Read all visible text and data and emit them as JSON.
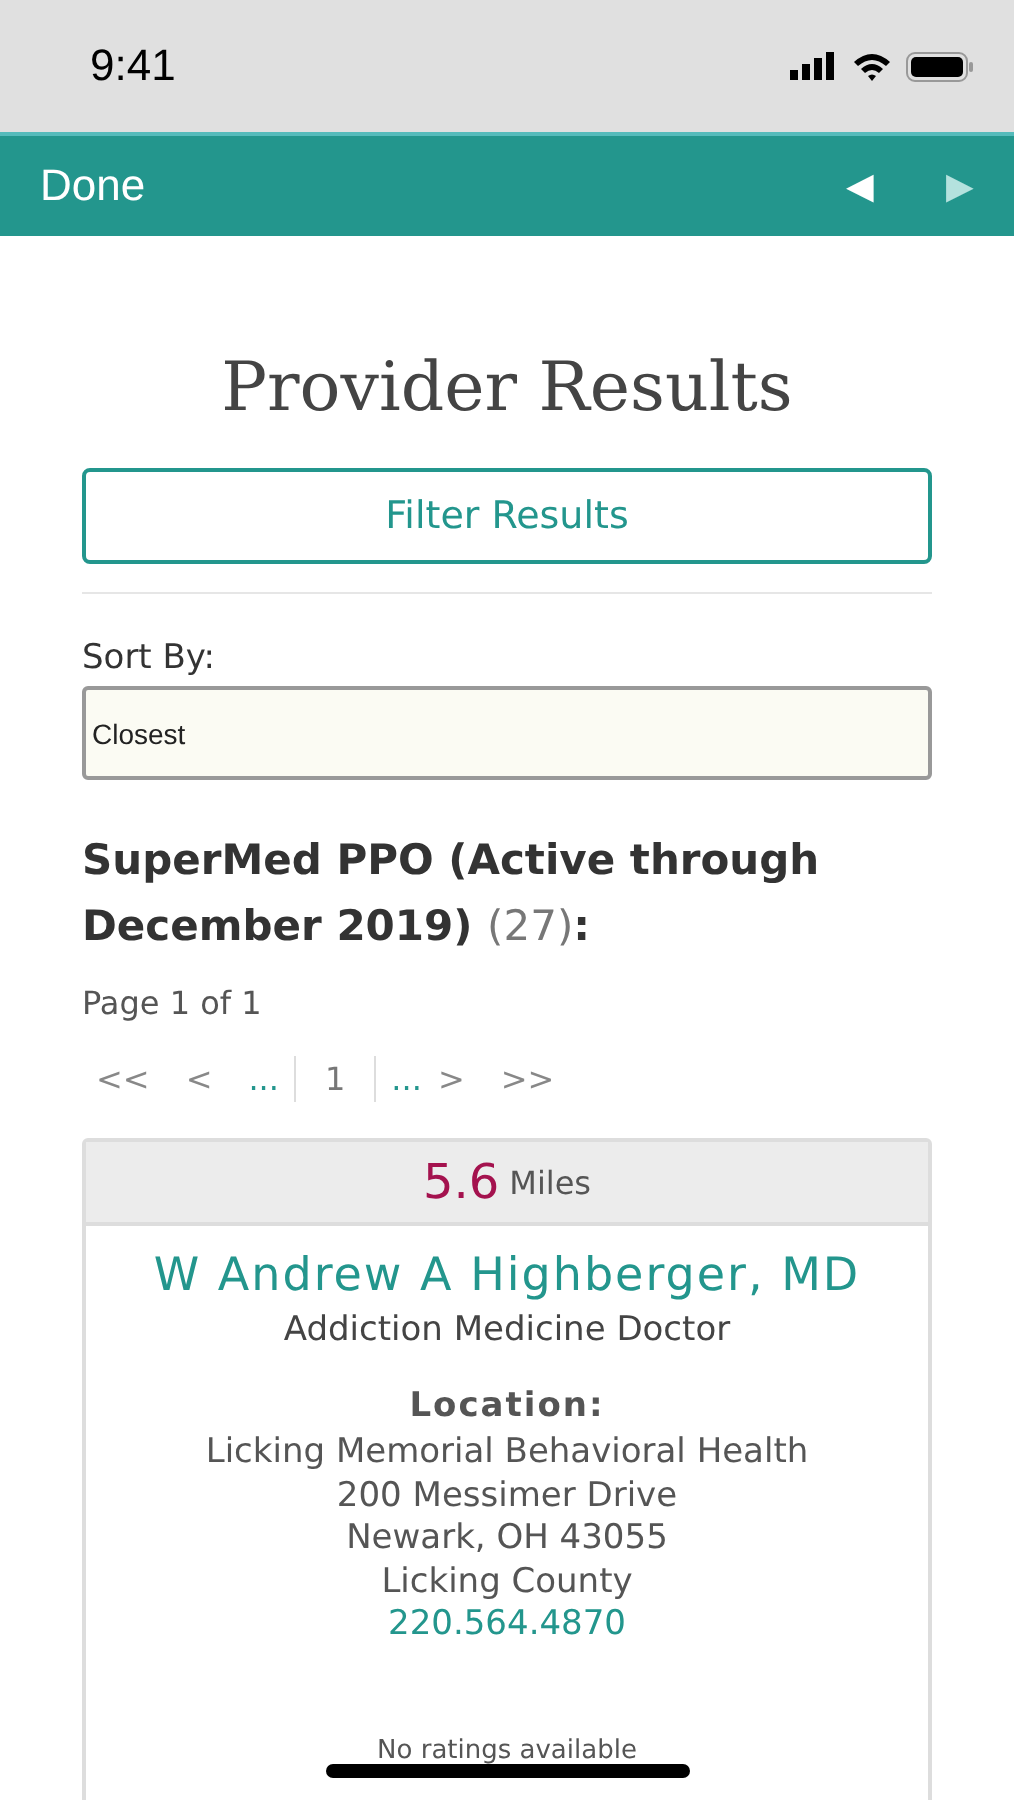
{
  "status_bar": {
    "time": "9:41"
  },
  "nav_bar": {
    "done": "Done",
    "back_arrow": {
      "label": "◀",
      "disabled": false
    },
    "forward_arrow": {
      "label": "▶",
      "disabled": true
    }
  },
  "title": "Provider Results",
  "filter_button": "Filter Results",
  "sort": {
    "label": "Sort By:",
    "value": "Closest"
  },
  "plan_heading": {
    "name": "SuperMed PPO (Active through December 2019)",
    "count": "(27)",
    "suffix": ":"
  },
  "page_info": "Page 1 of 1",
  "pager": [
    {
      "label": "<<",
      "kind": "nav"
    },
    {
      "label": "<",
      "kind": "nav"
    },
    {
      "label": "...",
      "kind": "ellipsis"
    },
    {
      "label": "1",
      "kind": "page",
      "selected": true
    },
    {
      "label": "...",
      "kind": "ellipsis"
    },
    {
      "label": ">",
      "kind": "nav"
    },
    {
      "label": ">>",
      "kind": "nav"
    }
  ],
  "provider": {
    "distance": "5.6",
    "unit": "Miles",
    "name": "W Andrew A Highberger, MD",
    "specialty": "Addiction Medicine Doctor",
    "location_label": "Location:",
    "address_lines": [
      "Licking Memorial Behavioral Health",
      "200 Messimer Drive",
      "Newark, OH 43055",
      "Licking County"
    ],
    "phone": "220.564.4870",
    "ratings": "No ratings available"
  }
}
